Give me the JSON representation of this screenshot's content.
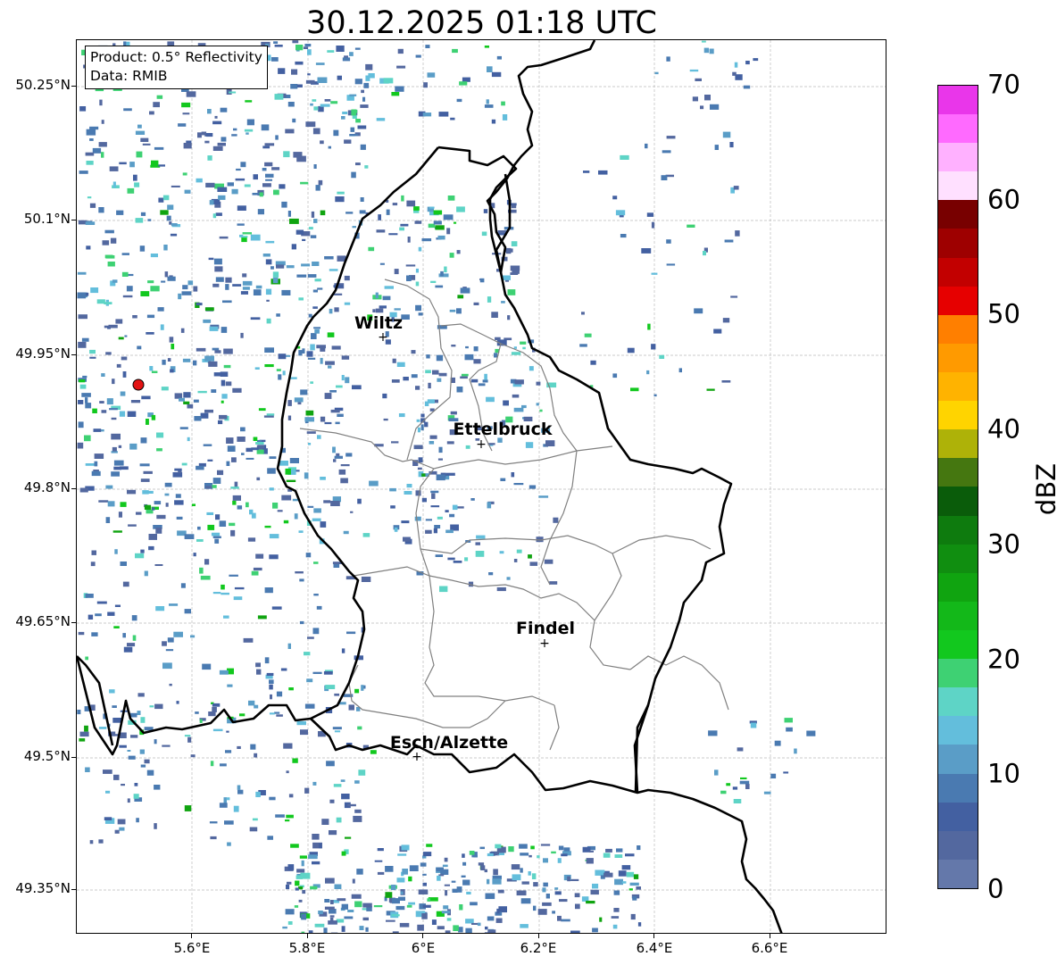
{
  "title": "30.12.2025 01:18 UTC",
  "info": {
    "product": "Product: 0.5° Reflectivity",
    "data": "Data: RMIB"
  },
  "axes": {
    "x_ticks": [
      "5.6°E",
      "5.8°E",
      "6°E",
      "6.2°E",
      "6.4°E",
      "6.6°E"
    ],
    "y_ticks": [
      "50.25°N",
      "50.1°N",
      "49.95°N",
      "49.8°N",
      "49.65°N",
      "49.5°N",
      "49.35°N"
    ]
  },
  "cities": [
    {
      "name": "Wiltz"
    },
    {
      "name": "Ettelbruck"
    },
    {
      "name": "Findel"
    },
    {
      "name": "Esch/Alzette"
    }
  ],
  "colorbar": {
    "unit": "dBZ",
    "labels": [
      "0",
      "10",
      "20",
      "30",
      "40",
      "50",
      "60",
      "70"
    ],
    "colors": [
      "#6478aa",
      "#53689f",
      "#4360a1",
      "#4a7ab1",
      "#5a9dc7",
      "#63bedc",
      "#5ed4c6",
      "#3ed173",
      "#12c81e",
      "#13b819",
      "#10a410",
      "#108e10",
      "#0e7b0e",
      "#0a5c0a",
      "#457710",
      "#aeb208",
      "#ffd400",
      "#ffb300",
      "#ff9a00",
      "#ff7f00",
      "#e60000",
      "#c20000",
      "#9e0000",
      "#780000",
      "#ffe0ff",
      "#ffb1ff",
      "#ff6aff",
      "#e936ea"
    ]
  }
}
